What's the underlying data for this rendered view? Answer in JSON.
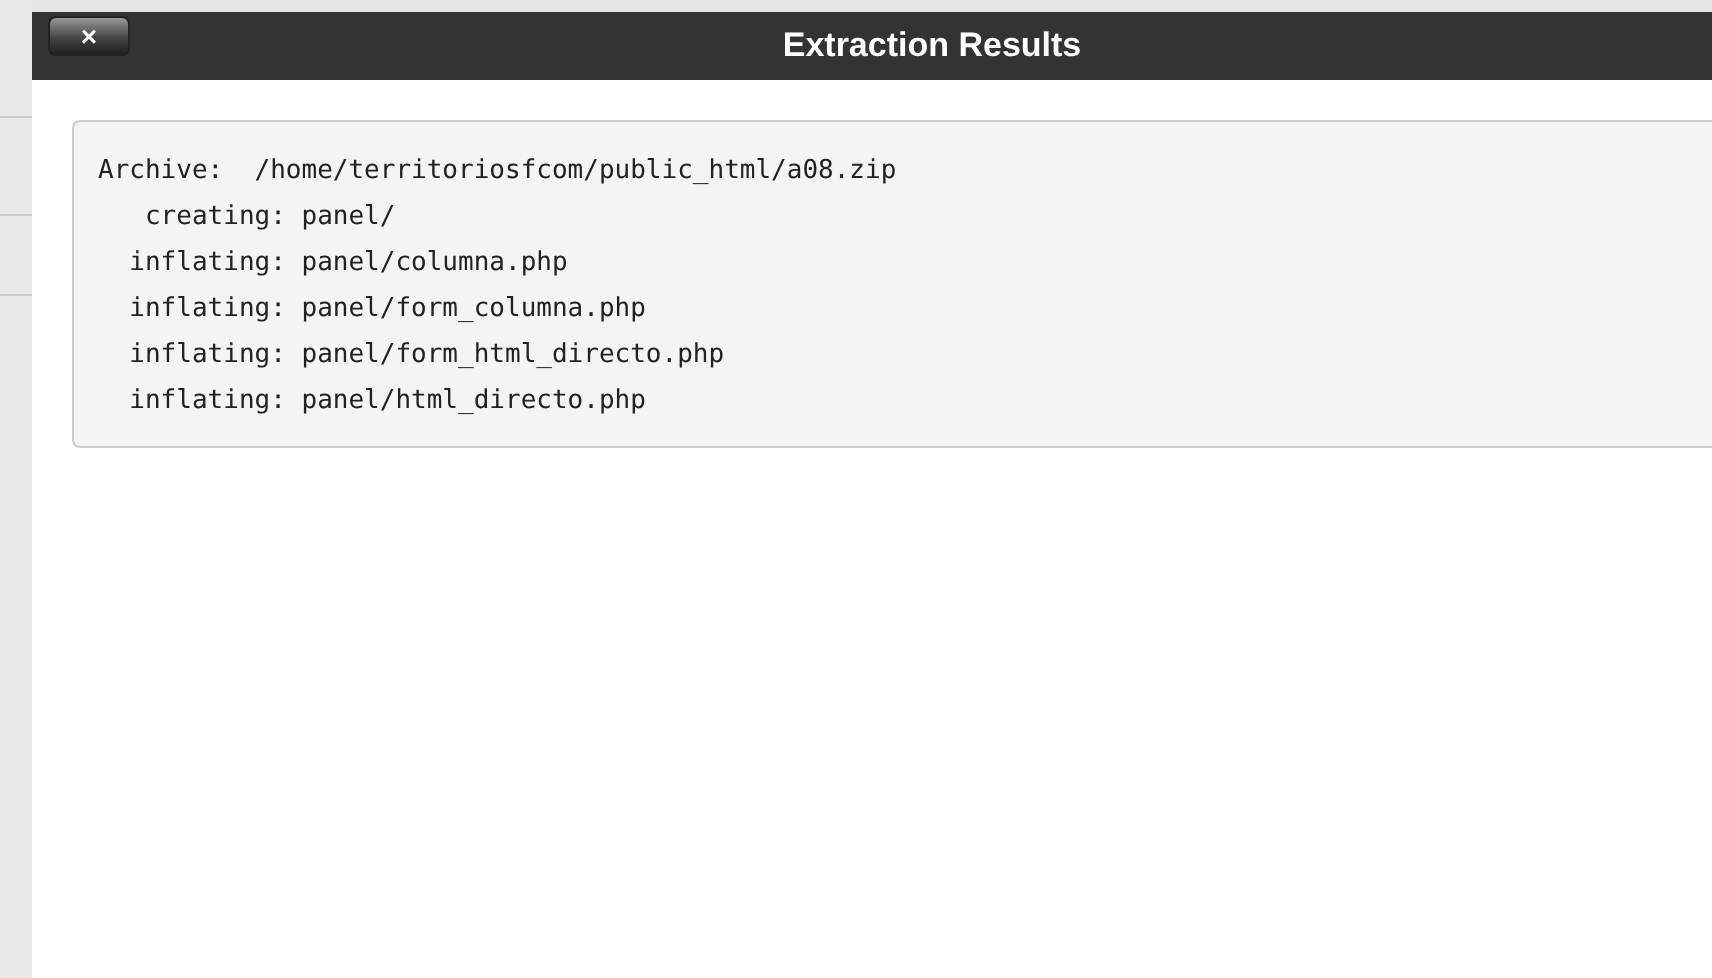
{
  "dialog": {
    "title": "Extraction Results",
    "close_button": "×",
    "output_lines": [
      "Archive:  /home/territoriosfcom/public_html/a08.zip",
      "   creating: panel/",
      "  inflating: panel/columna.php",
      "  inflating: panel/form_columna.php",
      "  inflating: panel/form_html_directo.php",
      "  inflating: panel/html_directo.php"
    ]
  }
}
